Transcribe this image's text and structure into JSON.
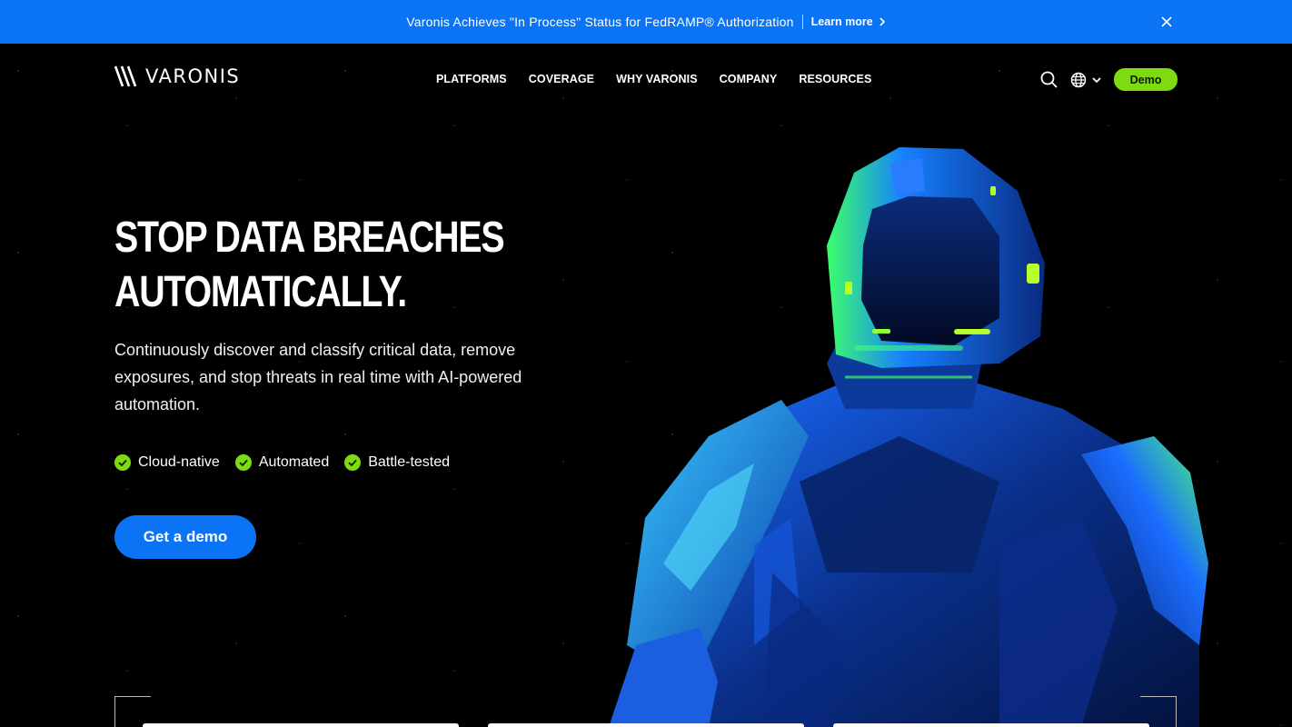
{
  "announcement": {
    "message": "Varonis Achieves \"In Process\" Status for FedRAMP® Authorization",
    "link_label": "Learn more",
    "background": "#0a74f5"
  },
  "nav": {
    "logo_text": "VARONIS",
    "menu": [
      "PLATFORMS",
      "COVERAGE",
      "WHY VARONIS",
      "COMPANY",
      "RESOURCES"
    ],
    "demo_label": "Demo",
    "demo_color": "#7ddb0f"
  },
  "hero": {
    "title_line1": "STOP DATA BREACHES",
    "title_line2": "AUTOMATICALLY.",
    "subtitle": "Continuously discover and classify critical data, remove exposures, and stop threats in real time with AI-powered automation.",
    "features": [
      "Cloud-native",
      "Automated",
      "Battle-tested"
    ],
    "cta_label": "Get a demo",
    "cta_color": "#0a74f5"
  },
  "icons": {
    "close": "close-icon",
    "chevron": "chevron-right-icon",
    "search": "search-icon",
    "globe": "globe-icon",
    "caret": "chevron-down-icon",
    "check": "check-circle-icon"
  }
}
